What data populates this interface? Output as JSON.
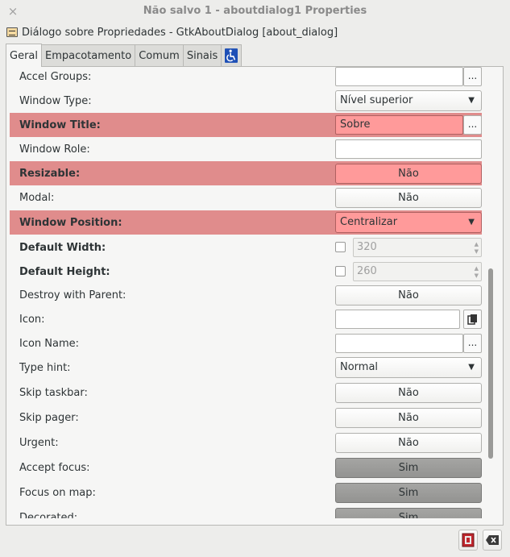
{
  "window": {
    "close_glyph": "×",
    "title": "Não salvo 1 - aboutdialog1 Properties"
  },
  "header": {
    "text": "Diálogo sobre Propriedades - GtkAboutDialog [about_dialog]"
  },
  "tabs": [
    {
      "label": "Geral",
      "active": true
    },
    {
      "label": "Empacotamento",
      "active": false
    },
    {
      "label": "Comum",
      "active": false
    },
    {
      "label": "Sinais",
      "active": false
    },
    {
      "label": "",
      "icon": "accessibility-icon",
      "active": false
    }
  ],
  "properties": [
    {
      "label": "Accel Groups:",
      "control": "entry-dots",
      "value": "",
      "bold": false,
      "highlighted": false
    },
    {
      "label": "Window Type:",
      "control": "combo",
      "value": "Nível superior",
      "bold": false,
      "highlighted": false
    },
    {
      "label": "Window Title:",
      "control": "entry-dots",
      "value": "Sobre",
      "bold": true,
      "highlighted": true
    },
    {
      "label": "Window Role:",
      "control": "entry",
      "value": "",
      "bold": false,
      "highlighted": false
    },
    {
      "label": "Resizable:",
      "control": "toggle",
      "value": "Não",
      "bold": true,
      "highlighted": true
    },
    {
      "label": "Modal:",
      "control": "toggle",
      "value": "Não",
      "bold": false,
      "highlighted": false
    },
    {
      "label": "Window Position:",
      "control": "combo",
      "value": "Centralizar",
      "bold": true,
      "highlighted": true
    },
    {
      "label": "Default Width:",
      "control": "check-spin",
      "value": "320",
      "bold": true,
      "highlighted": false
    },
    {
      "label": "Default Height:",
      "control": "check-spin",
      "value": "260",
      "bold": true,
      "highlighted": false
    },
    {
      "label": "Destroy with Parent:",
      "control": "toggle",
      "value": "Não",
      "bold": false,
      "highlighted": false
    },
    {
      "label": "Icon:",
      "control": "entry-icon",
      "value": "",
      "bold": false,
      "highlighted": false
    },
    {
      "label": "Icon Name:",
      "control": "entry-dots",
      "value": "",
      "bold": false,
      "highlighted": false
    },
    {
      "label": "Type hint:",
      "control": "combo",
      "value": "Normal",
      "bold": false,
      "highlighted": false
    },
    {
      "label": "Skip taskbar:",
      "control": "toggle",
      "value": "Não",
      "bold": false,
      "highlighted": false
    },
    {
      "label": "Skip pager:",
      "control": "toggle",
      "value": "Não",
      "bold": false,
      "highlighted": false
    },
    {
      "label": "Urgent:",
      "control": "toggle",
      "value": "Não",
      "bold": false,
      "highlighted": false
    },
    {
      "label": "Accept focus:",
      "control": "toggle-on",
      "value": "Sim",
      "bold": false,
      "highlighted": false
    },
    {
      "label": "Focus on map:",
      "control": "toggle-on",
      "value": "Sim",
      "bold": false,
      "highlighted": false
    },
    {
      "label": "Decorated:",
      "control": "toggle-on",
      "value": "Sim",
      "bold": false,
      "highlighted": false
    }
  ],
  "colors": {
    "highlight_row": "#e08c8c",
    "highlight_control": "#ff9a9a",
    "toggle_active": "#9e9e9c"
  },
  "buttons": {
    "dots_label": "...",
    "combo_arrow": "▼"
  },
  "bottom_icons": [
    "devhelp-icon",
    "clear-icon"
  ]
}
